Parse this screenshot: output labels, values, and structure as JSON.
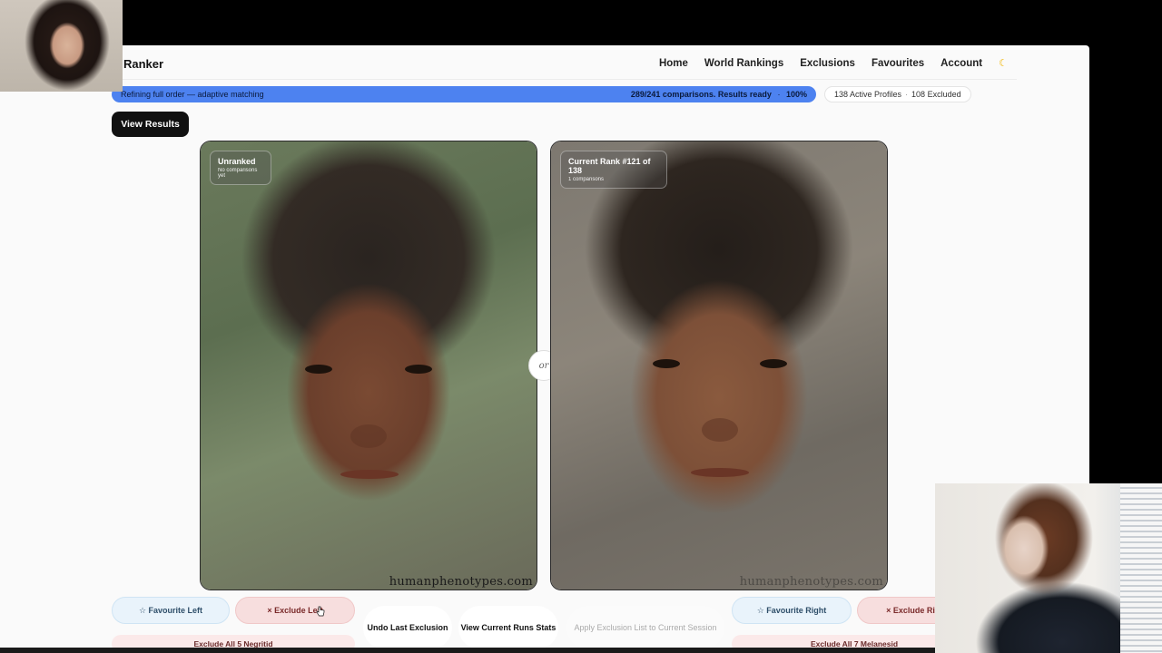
{
  "app": {
    "brand": "Ranker"
  },
  "nav": {
    "items": [
      "Home",
      "World Rankings",
      "Exclusions",
      "Favourites",
      "Account"
    ],
    "theme_icon": "moon-icon"
  },
  "progress": {
    "left_text": "Refining full order — adaptive matching",
    "right_text": "289/241 comparisons. Results ready",
    "sep": "·",
    "percent_text": "100%",
    "fill": 1.0,
    "color": "#4d82f0"
  },
  "stats": {
    "active": "138 Active Profiles",
    "sep": "·",
    "excluded": "108 Excluded"
  },
  "view_results": "View Results",
  "left_card": {
    "title": "Unranked",
    "subtitle": "No comparisons yet",
    "watermark": "humanphenotypes.com"
  },
  "right_card": {
    "title": "Current Rank #121 of 138",
    "subtitle": "1 comparisons",
    "watermark": "humanphenotypes.com"
  },
  "or_label": "or",
  "actions": {
    "favourite_left": "☆ Favourite Left",
    "exclude_left": "× Exclude Left",
    "undo": "Undo Last Exclusion",
    "view_stats": "View Current Runs Stats",
    "apply_exclusion": "Apply Exclusion List to Current Session",
    "favourite_right": "☆ Favourite Right",
    "exclude_right": "× Exclude Right",
    "exclude_all_left": "Exclude All 5 Negritid",
    "exclude_all_right": "Exclude All 7 Melanesid"
  }
}
